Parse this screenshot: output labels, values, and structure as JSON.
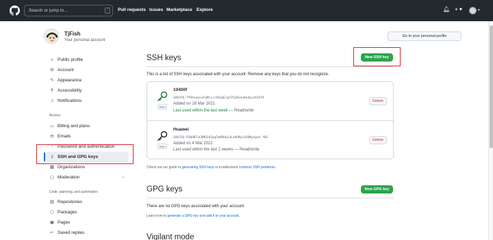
{
  "header": {
    "search_placeholder": "Search or jump to...",
    "search_key": "/",
    "nav": [
      "Pull requests",
      "Issues",
      "Marketplace",
      "Explore"
    ],
    "right_icons": [
      "bell-icon",
      "plus-icon",
      "avatar"
    ]
  },
  "profile": {
    "name": "TjFish",
    "subtitle": "Your personal account",
    "personal_profile_button": "Go to your personal profile"
  },
  "sidebar": {
    "items_top": [
      {
        "label": "Public profile",
        "icon": "person-icon"
      },
      {
        "label": "Account",
        "icon": "gear-icon"
      },
      {
        "label": "Appearance",
        "icon": "paintbrush-icon"
      },
      {
        "label": "Accessibility",
        "icon": "accessibility-icon"
      },
      {
        "label": "Notifications",
        "icon": "bell-icon"
      }
    ],
    "section_access": "Access",
    "items_access": [
      {
        "label": "Billing and plans",
        "icon": "credit-card-icon"
      },
      {
        "label": "Emails",
        "icon": "mail-icon"
      },
      {
        "label": "Password and authentication",
        "icon": "shield-lock-icon"
      },
      {
        "label": "SSH and GPG keys",
        "icon": "key-icon"
      },
      {
        "label": "Organizations",
        "icon": "organization-icon"
      },
      {
        "label": "Moderation",
        "icon": "report-icon"
      }
    ],
    "section_code": "Code, planning, and automation",
    "items_code": [
      {
        "label": "Repositories",
        "icon": "repo-icon"
      },
      {
        "label": "Packages",
        "icon": "package-icon"
      },
      {
        "label": "Pages",
        "icon": "browser-icon"
      },
      {
        "label": "Saved replies",
        "icon": "reply-icon"
      }
    ]
  },
  "ssh": {
    "title": "SSH keys",
    "new_button": "New SSH key",
    "description": "This is a list of SSH keys associated with your account. Remove any keys that you do not recognize.",
    "keys": [
      {
        "name": "10400f",
        "fingerprint": "SHA256:7YU5oaaiuFqMlz+/4H1pEcgf25yRenvKedpjnA1U74",
        "added": "Added on 28 Mar 2021",
        "used_recent": "Last used within the last week",
        "used_suffix": " — Read/write",
        "badge": "SSH",
        "delete": "Delete"
      },
      {
        "name": "Huawei",
        "fingerprint": "SHA256:P1bHR7uCKMU2kZgq5m8RHwL3LoV6Mjo1G8Ny4yuk f8E",
        "added": "Added on 4 Mar 2022",
        "used_recent": "",
        "used_suffix": "Last used within the last 2 weeks — Read/write",
        "badge": "SSH",
        "delete": "Delete"
      }
    ],
    "guide_prefix": "Check out our guide to ",
    "guide_link1": "generating SSH keys",
    "guide_mid": " or troubleshoot ",
    "guide_link2": "common SSH problems",
    "guide_suffix": "."
  },
  "gpg": {
    "title": "GPG keys",
    "new_button": "New GPG key",
    "empty": "There are no GPG keys associated with your account.",
    "learn_prefix": "Learn how to ",
    "learn_link": "generate a GPG key and add it to your account",
    "learn_suffix": "."
  },
  "vigilant": {
    "title": "Vigilant mode"
  },
  "colors": {
    "header_bg": "#24292f",
    "accent_blue": "#0969da",
    "success_green": "#2da44e",
    "danger_red": "#cf222e",
    "highlight_red_box": "#e0232a"
  }
}
